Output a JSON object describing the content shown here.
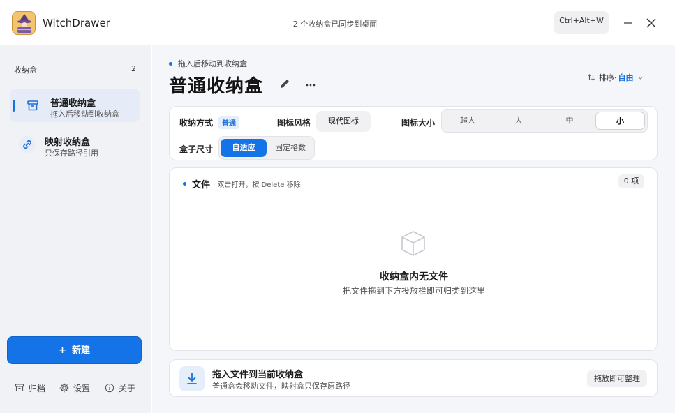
{
  "titlebar": {
    "app_name": "WitchDrawer",
    "sync_status": "2 个收纳盒已同步到桌面",
    "hotkey": "Ctrl+Alt+W"
  },
  "sidebar": {
    "header": "收纳盒",
    "count": "2",
    "items": [
      {
        "name": "普通收纳盒",
        "desc": "拖入后移动到收纳盒",
        "icon": "archive-box-icon"
      },
      {
        "name": "映射收纳盒",
        "desc": "只保存路径引用",
        "icon": "link-icon"
      }
    ],
    "new_button": {
      "plus": "+",
      "label": "新建"
    },
    "footer": {
      "archive": "归档",
      "settings": "设置",
      "about": "关于"
    }
  },
  "main": {
    "breadcrumb": "拖入后移动到收纳盒",
    "title": "普通收纳盒",
    "sort": {
      "label": "排序·",
      "value": "自由"
    },
    "settings": {
      "storage_label": "收纳方式",
      "storage_value": "普通",
      "icon_style_label": "图标风格",
      "icon_style_value": "现代图标",
      "icon_size_label": "图标大小",
      "icon_size_options": [
        "超大",
        "大",
        "中",
        "小"
      ],
      "icon_size_selected": "小",
      "box_size_label": "盒子尺寸",
      "box_size_options": [
        "自适应",
        "固定格数"
      ],
      "box_size_selected": "自适应"
    },
    "files": {
      "title": "文件",
      "hint": "· 双击打开，按 Delete 移除",
      "count": "0 项",
      "empty_title": "收纳盒内无文件",
      "empty_subtitle": "把文件拖到下方投放栏即可归类到这里"
    },
    "drop": {
      "title": "拖入文件到当前收纳盒",
      "subtitle": "普通盒会移动文件，映射盒只保存原路径",
      "badge": "拖放即可整理"
    }
  },
  "colors": {
    "accent": "#1473e6",
    "accent_soft": "#e5eefb",
    "sidebar_bg": "#f1f2f6",
    "main_bg": "#f5f6fa"
  }
}
